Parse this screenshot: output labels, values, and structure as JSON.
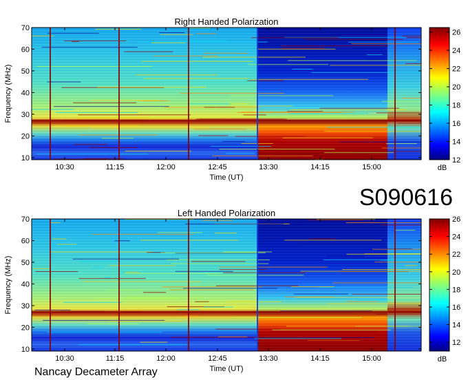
{
  "event_id": "S090616",
  "footer": "Nancay Decameter Array",
  "chart_data": [
    {
      "type": "heatmap",
      "title": "Right Handed Polarization",
      "xlabel": "Time (UT)",
      "ylabel": "Frequency (MHz)",
      "x_ticks": [
        "10:30",
        "11:15",
        "12:00",
        "12:45",
        "13:30",
        "14:15",
        "15:00"
      ],
      "y_ticks": [
        10,
        20,
        30,
        40,
        50,
        60,
        70
      ],
      "ylim": [
        9,
        70
      ],
      "colorbar": {
        "label": "dB",
        "ticks": [
          12,
          14,
          16,
          18,
          20,
          22,
          24,
          26
        ],
        "range": [
          12,
          26.5
        ]
      },
      "colormap": "jet"
    },
    {
      "type": "heatmap",
      "title": "Left Handed Polarization",
      "xlabel": "Time (UT)",
      "ylabel": "Frequency (MHz)",
      "x_ticks": [
        "10:30",
        "11:15",
        "12:00",
        "12:45",
        "13:30",
        "14:15",
        "15:00"
      ],
      "y_ticks": [
        10,
        20,
        30,
        40,
        50,
        60,
        70
      ],
      "ylim": [
        9,
        70
      ],
      "colorbar": {
        "label": "dB",
        "ticks": [
          12,
          14,
          16,
          18,
          20,
          22,
          24,
          26
        ],
        "range": [
          11,
          26
        ]
      },
      "colormap": "jet"
    }
  ]
}
